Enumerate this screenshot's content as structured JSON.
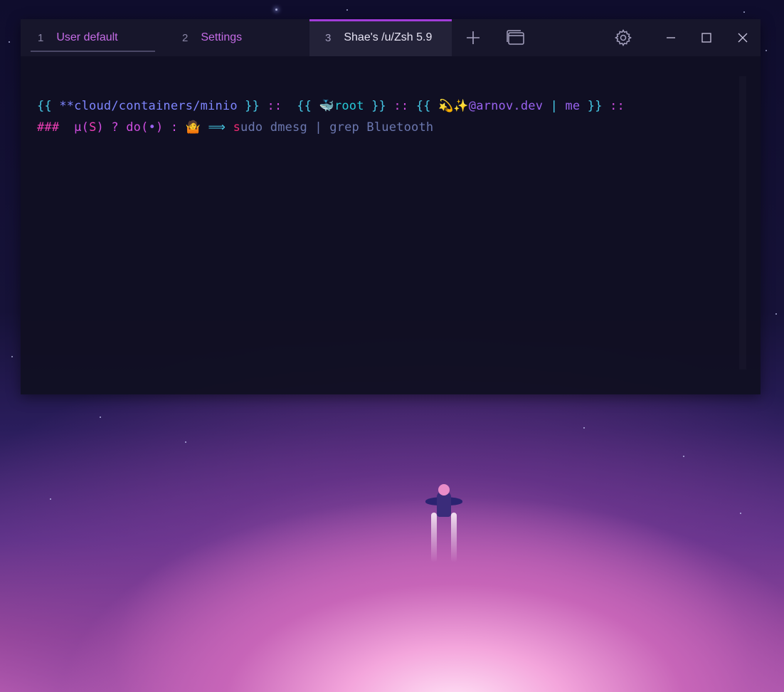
{
  "tabs": [
    {
      "number": "1",
      "label": "User default"
    },
    {
      "number": "2",
      "label": "Settings"
    },
    {
      "number": "3",
      "label": "Shae's /u/Zsh 5.9"
    }
  ],
  "titlebar_icons": [
    "plus-icon",
    "panes-icon",
    "gear-icon",
    "minimize-icon",
    "maximize-icon",
    "close-icon"
  ],
  "terminal": {
    "line1": {
      "open1": "{{ ",
      "path": "**cloud/containers/minio",
      "close1": " }}",
      "sep1": " :: ",
      "open2": " {{ ",
      "whale": "🐳",
      "user": "root",
      "close2": " }}",
      "sep2": " :: ",
      "open3": "{{ ",
      "sparkles": "💫✨",
      "handle": "@arnov.dev",
      "pipe": " | ",
      "me": "me",
      "close3": " }}",
      "sep3": " ::"
    },
    "line2": {
      "hashes": "###",
      "mu": "  μ(",
      "s": "S",
      "mu_close": ")",
      "q": " ? ",
      "do_open": "do(",
      "dot": "•",
      "do_close": ")",
      "colon": " : ",
      "shrug": "🤷",
      "arrow": " ⟹ ",
      "cmd_first": "s",
      "cmd_rest": "udo dmesg ",
      "cmd_pipe": "| ",
      "cmd_grep": "grep Bluetooth"
    }
  },
  "colors": {
    "accent": "#a13cd8",
    "tab_text": "#c56ce6",
    "cyan": "#46c9e6",
    "blue": "#7f86ff",
    "magenta": "#d04ee0"
  }
}
